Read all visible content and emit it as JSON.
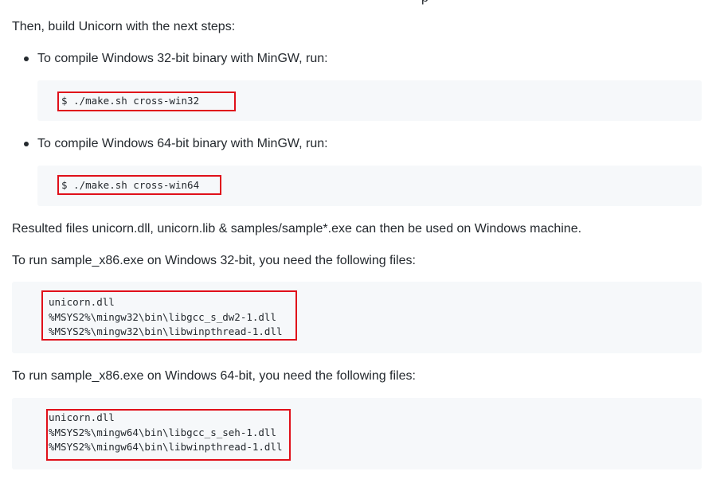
{
  "partial_top_text": "p",
  "intro": "Then, build Unicorn with the next steps:",
  "steps": [
    {
      "text": "To compile Windows 32-bit binary with MinGW, run:",
      "command": "$ ./make.sh cross-win32"
    },
    {
      "text": "To compile Windows 64-bit binary with MinGW, run:",
      "command": "$ ./make.sh cross-win64"
    }
  ],
  "resulted_files_text": "Resulted files unicorn.dll, unicorn.lib & samples/sample*.exe can then be used on Windows machine.",
  "run32": {
    "text": "To run sample_x86.exe on Windows 32-bit, you need the following files:",
    "files": [
      "unicorn.dll",
      "%MSYS2%\\mingw32\\bin\\libgcc_s_dw2-1.dll",
      "%MSYS2%\\mingw32\\bin\\libwinpthread-1.dll"
    ]
  },
  "run64": {
    "text": "To run sample_x86.exe on Windows 64-bit, you need the following files:",
    "files": [
      "unicorn.dll",
      "%MSYS2%\\mingw64\\bin\\libgcc_s_seh-1.dll",
      "%MSYS2%\\mingw64\\bin\\libwinpthread-1.dll"
    ]
  },
  "colors": {
    "highlight": "#e0101a",
    "code_background": "#f6f8fa",
    "text": "#24292e"
  }
}
